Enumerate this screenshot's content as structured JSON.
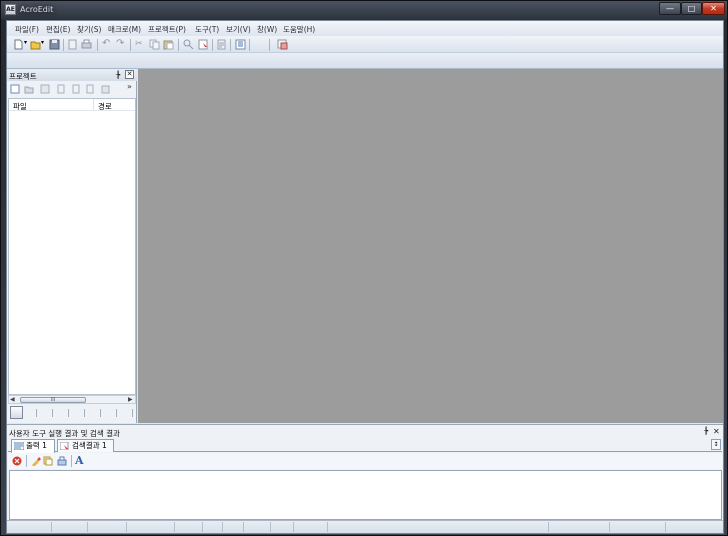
{
  "window": {
    "title": "AcroEdit",
    "app_icon_text": "AE"
  },
  "menu": [
    "파일(F)",
    "편집(E)",
    "찾기(S)",
    "매크로(M)",
    "프로젝트(P)",
    "도구(T)",
    "보기(V)",
    "창(W)",
    "도움말(H)"
  ],
  "project_panel": {
    "title": "프로젝트",
    "columns": [
      "파일",
      "경로"
    ],
    "scroll_grip": "III"
  },
  "output_panel": {
    "title": "사용자 도구 실행 결과 및 검색 결과",
    "tabs": [
      "출력 1",
      "검색결과 1"
    ]
  },
  "colors": {
    "editor_background": "#9c9c9c",
    "chrome": "#dfe6ef",
    "close_button": "#c13b26"
  }
}
